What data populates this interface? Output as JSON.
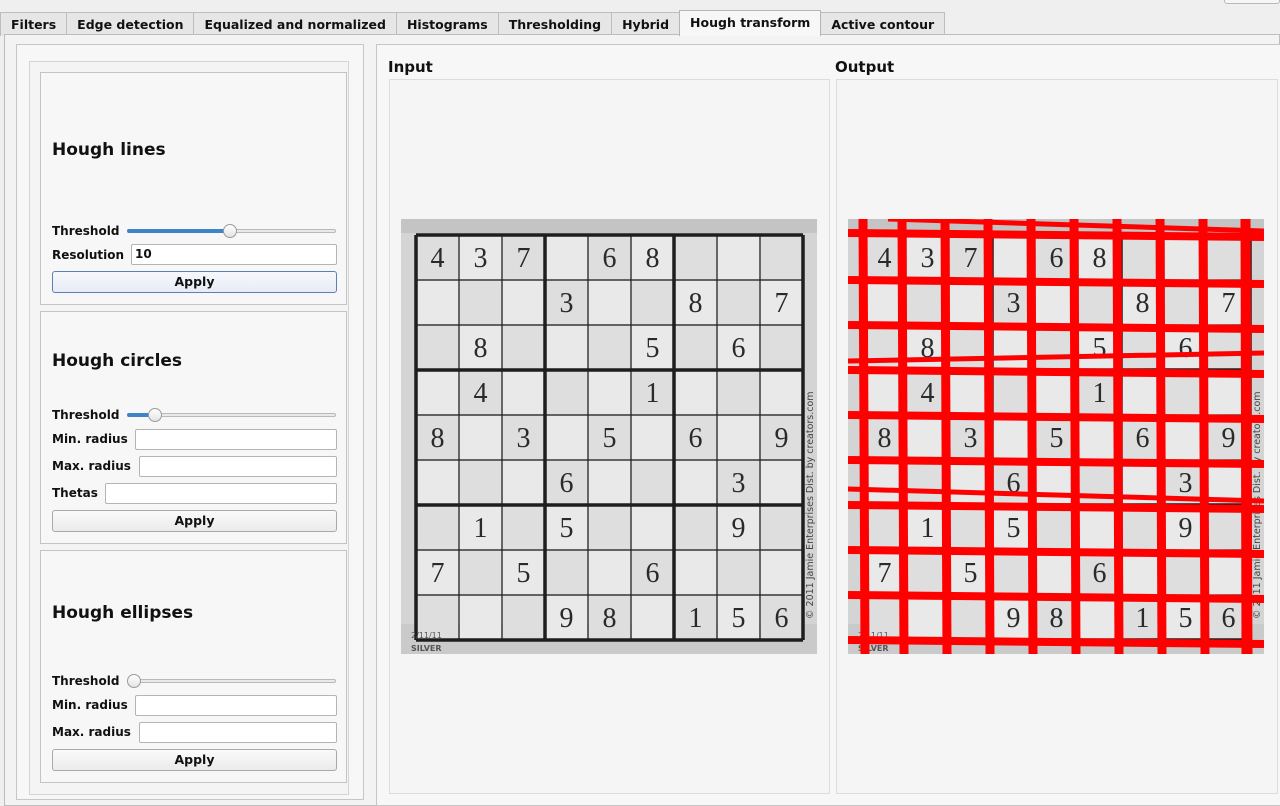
{
  "tabs": [
    {
      "label": "Filters"
    },
    {
      "label": "Edge detection"
    },
    {
      "label": "Equalized and normalized"
    },
    {
      "label": "Histograms"
    },
    {
      "label": "Thresholding"
    },
    {
      "label": "Hybrid"
    },
    {
      "label": "Hough transform"
    },
    {
      "label": "Active contour"
    }
  ],
  "active_tab_index": 6,
  "hough_lines": {
    "title": "Hough lines",
    "threshold_label": "Threshold",
    "threshold_value": 0.49,
    "resolution_label": "Resolution",
    "resolution_value": "10",
    "apply_label": "Apply"
  },
  "hough_circles": {
    "title": "Hough circles",
    "threshold_label": "Threshold",
    "threshold_value": 0.11,
    "min_radius_label": "Min. radius",
    "min_radius_value": "",
    "max_radius_label": "Max. radius",
    "max_radius_value": "",
    "thetas_label": "Thetas",
    "thetas_value": "",
    "apply_label": "Apply"
  },
  "hough_ellipses": {
    "title": "Hough ellipses",
    "threshold_label": "Threshold",
    "threshold_value": 0.0,
    "min_radius_label": "Min. radius",
    "min_radius_value": "",
    "max_radius_label": "Max. radius",
    "max_radius_value": "",
    "apply_label": "Apply"
  },
  "input_view": {
    "label": "Input"
  },
  "output_view": {
    "label": "Output"
  },
  "sudoku": {
    "grid": [
      [
        "4",
        "3",
        "7",
        "",
        "6",
        "8",
        "",
        "",
        ""
      ],
      [
        "",
        "",
        "",
        "3",
        "",
        "",
        "8",
        "",
        "7"
      ],
      [
        "",
        "8",
        "",
        "",
        "",
        "5",
        "",
        "6",
        ""
      ],
      [
        "",
        "4",
        "",
        "",
        "",
        "1",
        "",
        "",
        ""
      ],
      [
        "8",
        "",
        "3",
        "",
        "5",
        "",
        "6",
        "",
        "9"
      ],
      [
        "",
        "",
        "",
        "6",
        "",
        "",
        "",
        "3",
        ""
      ],
      [
        "",
        "1",
        "",
        "5",
        "",
        "",
        "",
        "9",
        ""
      ],
      [
        "7",
        "",
        "5",
        "",
        "",
        "6",
        "",
        "",
        ""
      ],
      [
        "",
        "",
        "",
        "9",
        "8",
        "",
        "1",
        "5",
        "6"
      ]
    ],
    "side_text": "© 2011 Jamie Enterprises Dist. by creators.com",
    "corner_text": "2/11/11",
    "corner_text2": "SILVER"
  },
  "colors": {
    "accent": "#3f84c6",
    "detected_line": "#ff0000",
    "photo_paper": "#d4d4d4",
    "grid_ink": "#1e1e1e"
  }
}
